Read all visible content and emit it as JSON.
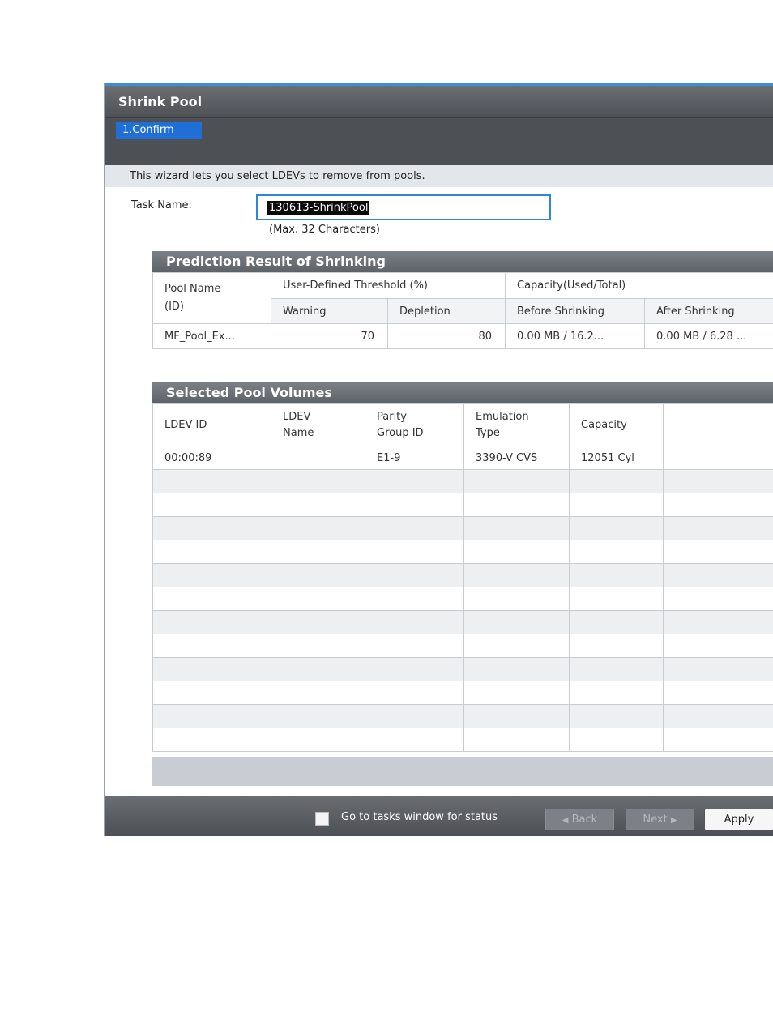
{
  "window": {
    "title": "Shrink Pool",
    "steps": [
      "1.Confirm"
    ],
    "description": "This wizard lets you select LDEVs to remove from pools."
  },
  "task": {
    "label": "Task Name:",
    "value": "130613-ShrinkPool",
    "hint": "(Max. 32 Characters)"
  },
  "prediction": {
    "title": "Prediction Result of Shrinking",
    "headers": {
      "pool_name": "Pool Name",
      "pool_id": "(ID)",
      "threshold": "User-Defined Threshold (%)",
      "warning": "Warning",
      "depletion": "Depletion",
      "capacity": "Capacity(Used/Total)",
      "before": "Before Shrinking",
      "after": "After Shrinking"
    },
    "rows": [
      {
        "pool": "MF_Pool_Ex...",
        "warning": "70",
        "depletion": "80",
        "before": "0.00 MB / 16.2...",
        "after": "0.00 MB / 6.28 ..."
      }
    ]
  },
  "volumes": {
    "title": "Selected Pool Volumes",
    "headers": {
      "ldev_id": "LDEV ID",
      "ldev_name_1": "LDEV",
      "ldev_name_2": "Name",
      "parity_1": "Parity",
      "parity_2": "Group ID",
      "emulation_1": "Emulation",
      "emulation_2": "Type",
      "capacity": "Capacity"
    },
    "rows": [
      {
        "ldev_id": "00:00:89",
        "ldev_name": "",
        "parity_group": "E1-9",
        "emulation": "3390-V CVS",
        "capacity": "12051 Cyl"
      }
    ]
  },
  "footer": {
    "checkbox_label": "Go to tasks window for status",
    "checkbox_checked": false,
    "back": "Back",
    "next": "Next",
    "apply": "Apply"
  }
}
